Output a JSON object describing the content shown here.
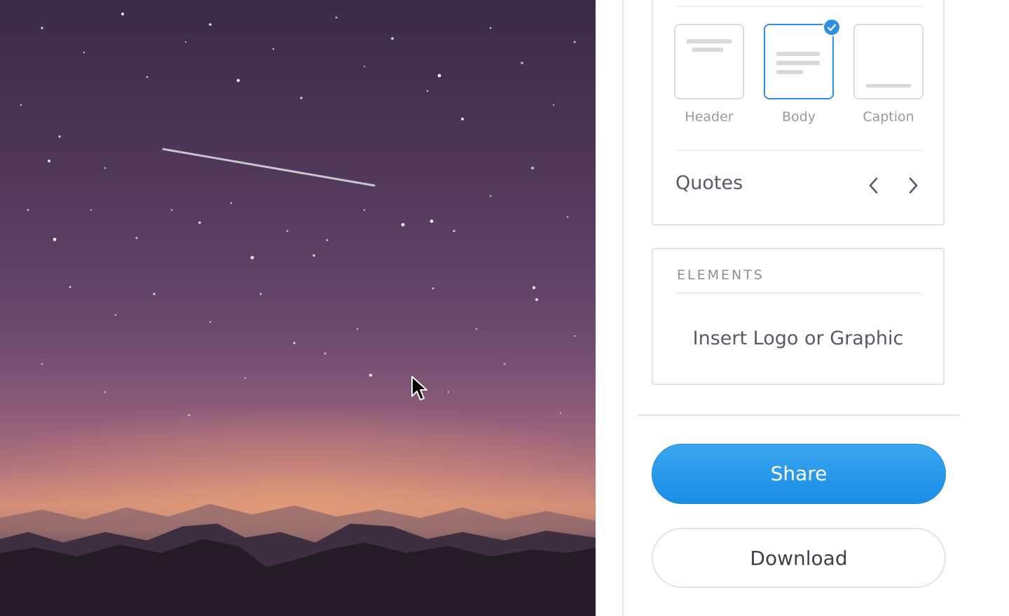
{
  "text_styles": {
    "items": [
      {
        "label": "Header",
        "selected": false
      },
      {
        "label": "Body",
        "selected": true
      },
      {
        "label": "Caption",
        "selected": false
      }
    ]
  },
  "quotes": {
    "title": "Quotes",
    "prev_icon": "chevron-left-icon",
    "next_icon": "chevron-right-icon"
  },
  "elements": {
    "heading": "ELEMENTS",
    "insert_label": "Insert Logo or Graphic"
  },
  "actions": {
    "share_label": "Share",
    "download_label": "Download"
  },
  "colors": {
    "accent": "#2d8fe3",
    "share_button": "#1a8de6",
    "text_primary": "#555c63",
    "text_muted": "#9a9a9a"
  }
}
